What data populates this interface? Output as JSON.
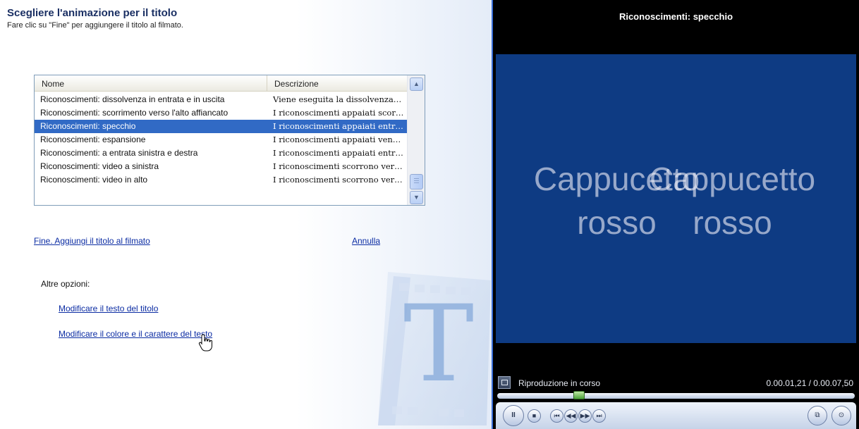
{
  "header": {
    "title": "Scegliere l'animazione per il titolo",
    "subtitle": "Fare clic su \"Fine\" per aggiungere il titolo al filmato."
  },
  "list": {
    "columns": [
      "Nome",
      "Descrizione"
    ],
    "rows": [
      {
        "name": "Riconoscimenti: dissolvenza in entrata e in uscita",
        "desc": "Viene eseguita la dissolvenza…",
        "selected": false
      },
      {
        "name": "Riconoscimenti: scorrimento verso l'alto affiancato",
        "desc": "I riconoscimenti appaiati scor…",
        "selected": false
      },
      {
        "name": "Riconoscimenti: specchio",
        "desc": "I riconoscimenti appaiati entr…",
        "selected": true
      },
      {
        "name": "Riconoscimenti: espansione",
        "desc": "I riconoscimenti appaiati ven…",
        "selected": false
      },
      {
        "name": "Riconoscimenti: a entrata sinistra e destra",
        "desc": "I riconoscimenti appaiati entr…",
        "selected": false
      },
      {
        "name": "Riconoscimenti: video a sinistra",
        "desc": "I riconoscimenti scorrono ver…",
        "selected": false
      },
      {
        "name": "Riconoscimenti: video in alto",
        "desc": "I riconoscimenti scorrono ver…",
        "selected": false
      }
    ]
  },
  "actions": {
    "done": "Fine. Aggiungi il titolo al filmato",
    "cancel": "Annulla"
  },
  "more": {
    "label": "Altre opzioni:",
    "edit_text": "Modificare il testo del titolo",
    "edit_font": "Modificare il colore e il carattere del testo"
  },
  "decoration": {
    "letter": "T"
  },
  "preview": {
    "title": "Riconoscimenti: specchio",
    "video_left": [
      "Cappucetto",
      "rosso"
    ],
    "video_right": [
      "Cappucetto",
      "rosso"
    ],
    "status": "Riproduzione in corso",
    "time": "0.00.01,21 / 0.00.07,50",
    "progress": 0.22
  },
  "controls": {
    "pause": "II",
    "stop": "■",
    "prev": "⏮",
    "rewind": "◀◀",
    "forward": "▶▶",
    "next": "⏭"
  },
  "colors": {
    "selection": "#316ac5",
    "link": "#0b2ca3",
    "video_bg": "#0e3b83"
  }
}
